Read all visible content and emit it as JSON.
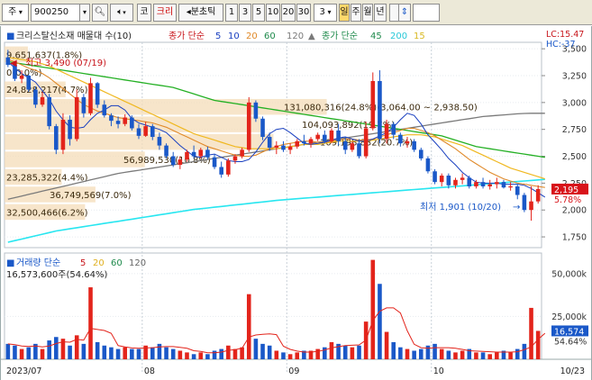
{
  "toolbar": {
    "market": "주",
    "code": "900250",
    "name_btn": "코",
    "name_text": "크리",
    "view_btn": "◂분초틱",
    "periods": [
      "1",
      "3",
      "5",
      "10",
      "20",
      "30"
    ],
    "period_count": "3",
    "units": [
      "일",
      "주",
      "월",
      "년"
    ],
    "selected_unit": "일"
  },
  "legend": {
    "title": "크리스탈신소재 매물대 수(10)",
    "ma_label": "종가 단순",
    "ma_periods": [
      "5",
      "10",
      "20",
      "60",
      "120"
    ],
    "ma_label2": "종가 단순",
    "ma_periods2": [
      "45",
      "200",
      "15"
    ],
    "lc": "LC:15.47",
    "hc": "HC:-37."
  },
  "price_annotations": {
    "high": "최고 3,490 (07/19)",
    "low": "최저 1,901 (10/20)",
    "current_price": "2,195",
    "current_pct": "5.78%"
  },
  "volume_profile": [
    {
      "label": "9,651,637(1.8%)",
      "pct": 1.8
    },
    {
      "label": "0(0.0%)",
      "pct": 0.0
    },
    {
      "label": "24,828,217(4.7%)",
      "pct": 4.7
    },
    {
      "label": "131,080,316(24.8%)(3,064.00 ~ 2,938.50)",
      "pct": 24.8
    },
    {
      "label": "104,093,892(19.7%)",
      "pct": 19.7
    },
    {
      "label": "109,198,832(20.7%)",
      "pct": 20.7
    },
    {
      "label": "56,989,530(10.8%)",
      "pct": 10.8
    },
    {
      "label": "23,285,322(4.4%)",
      "pct": 4.4
    },
    {
      "label": "36,749,569(7.0%)",
      "pct": 7.0
    },
    {
      "label": "32,500,466(6.2%)",
      "pct": 6.2
    }
  ],
  "price_axis": [
    "3,500",
    "3,250",
    "3,000",
    "2,750",
    "2,500",
    "2,250",
    "2,000",
    "1,750"
  ],
  "volume_legend": {
    "label": "거래량 단순",
    "periods": [
      "5",
      "20",
      "60",
      "120"
    ],
    "current": "16,573,600주(54.64%)"
  },
  "volume_axis": [
    "50,000k",
    "25,000k"
  ],
  "volume_current": "16,574",
  "volume_pct": "54.64%",
  "date_axis": [
    "2023/07",
    "08",
    "09",
    "10",
    "10/23"
  ],
  "colors": {
    "up": "#e3241b",
    "down": "#1a58c8",
    "ma5": "#1a40c0",
    "ma10": "#e08a2a",
    "ma20": "#f0b820",
    "ma60": "#24b024",
    "ma120": "#7a7a7a",
    "ma45": "#1f8a4c",
    "ma200": "#28e6f0",
    "ma15": "#e8cc30",
    "profile": "#f4dcb8"
  },
  "chart_data": {
    "type": "candlestick",
    "ylim": [
      1650,
      3560
    ],
    "volume_ylim": [
      0,
      62000
    ],
    "candles": [
      {
        "o": 3420,
        "h": 3490,
        "l": 3330,
        "c": 3350,
        "v": 9000
      },
      {
        "o": 3350,
        "h": 3380,
        "l": 3200,
        "c": 3220,
        "v": 8000
      },
      {
        "o": 3220,
        "h": 3300,
        "l": 3180,
        "c": 3250,
        "v": 6000
      },
      {
        "o": 3250,
        "h": 3260,
        "l": 3100,
        "c": 3120,
        "v": 7000
      },
      {
        "o": 3120,
        "h": 3150,
        "l": 2950,
        "c": 2980,
        "v": 9000
      },
      {
        "o": 2980,
        "h": 3100,
        "l": 2960,
        "c": 3050,
        "v": 6000
      },
      {
        "o": 3050,
        "h": 3080,
        "l": 2750,
        "c": 2780,
        "v": 11000
      },
      {
        "o": 2780,
        "h": 2800,
        "l": 2520,
        "c": 2560,
        "v": 13000
      },
      {
        "o": 2560,
        "h": 2900,
        "l": 2520,
        "c": 2840,
        "v": 12000
      },
      {
        "o": 2840,
        "h": 2880,
        "l": 2600,
        "c": 2660,
        "v": 8000
      },
      {
        "o": 2660,
        "h": 3120,
        "l": 2640,
        "c": 3050,
        "v": 14000
      },
      {
        "o": 3050,
        "h": 3080,
        "l": 2860,
        "c": 2900,
        "v": 9000
      },
      {
        "o": 2900,
        "h": 3230,
        "l": 2880,
        "c": 3180,
        "v": 42000
      },
      {
        "o": 3180,
        "h": 3190,
        "l": 2950,
        "c": 2980,
        "v": 10000
      },
      {
        "o": 2980,
        "h": 3020,
        "l": 2860,
        "c": 2880,
        "v": 8000
      },
      {
        "o": 2880,
        "h": 2900,
        "l": 2780,
        "c": 2830,
        "v": 7000
      },
      {
        "o": 2830,
        "h": 2870,
        "l": 2760,
        "c": 2800,
        "v": 6000
      },
      {
        "o": 2800,
        "h": 2890,
        "l": 2780,
        "c": 2860,
        "v": 7000
      },
      {
        "o": 2860,
        "h": 2880,
        "l": 2740,
        "c": 2760,
        "v": 6000
      },
      {
        "o": 2760,
        "h": 2800,
        "l": 2660,
        "c": 2690,
        "v": 6000
      },
      {
        "o": 2690,
        "h": 2820,
        "l": 2680,
        "c": 2780,
        "v": 8000
      },
      {
        "o": 2780,
        "h": 2800,
        "l": 2650,
        "c": 2680,
        "v": 7000
      },
      {
        "o": 2680,
        "h": 2720,
        "l": 2560,
        "c": 2600,
        "v": 9000
      },
      {
        "o": 2600,
        "h": 2620,
        "l": 2480,
        "c": 2500,
        "v": 7000
      },
      {
        "o": 2500,
        "h": 2540,
        "l": 2400,
        "c": 2420,
        "v": 6000
      },
      {
        "o": 2420,
        "h": 2500,
        "l": 2380,
        "c": 2470,
        "v": 5000
      },
      {
        "o": 2470,
        "h": 2560,
        "l": 2450,
        "c": 2540,
        "v": 4000
      },
      {
        "o": 2540,
        "h": 2600,
        "l": 2480,
        "c": 2500,
        "v": 3000
      },
      {
        "o": 2500,
        "h": 2580,
        "l": 2480,
        "c": 2560,
        "v": 4000
      },
      {
        "o": 2560,
        "h": 2590,
        "l": 2470,
        "c": 2490,
        "v": 3000
      },
      {
        "o": 2490,
        "h": 2520,
        "l": 2380,
        "c": 2400,
        "v": 5000
      },
      {
        "o": 2400,
        "h": 2450,
        "l": 2300,
        "c": 2330,
        "v": 6000
      },
      {
        "o": 2330,
        "h": 2480,
        "l": 2310,
        "c": 2460,
        "v": 8000
      },
      {
        "o": 2460,
        "h": 2520,
        "l": 2430,
        "c": 2500,
        "v": 6000
      },
      {
        "o": 2500,
        "h": 2580,
        "l": 2480,
        "c": 2560,
        "v": 7000
      },
      {
        "o": 2560,
        "h": 3050,
        "l": 2540,
        "c": 3000,
        "v": 38000
      },
      {
        "o": 3000,
        "h": 3020,
        "l": 2820,
        "c": 2850,
        "v": 12000
      },
      {
        "o": 2850,
        "h": 2870,
        "l": 2650,
        "c": 2680,
        "v": 9000
      },
      {
        "o": 2680,
        "h": 2720,
        "l": 2550,
        "c": 2580,
        "v": 8000
      },
      {
        "o": 2580,
        "h": 2640,
        "l": 2520,
        "c": 2600,
        "v": 5000
      },
      {
        "o": 2600,
        "h": 2640,
        "l": 2540,
        "c": 2560,
        "v": 4000
      },
      {
        "o": 2560,
        "h": 2620,
        "l": 2520,
        "c": 2590,
        "v": 3000
      },
      {
        "o": 2590,
        "h": 2660,
        "l": 2570,
        "c": 2640,
        "v": 4000
      },
      {
        "o": 2640,
        "h": 2700,
        "l": 2600,
        "c": 2620,
        "v": 5000
      },
      {
        "o": 2620,
        "h": 2680,
        "l": 2580,
        "c": 2660,
        "v": 5000
      },
      {
        "o": 2660,
        "h": 2720,
        "l": 2640,
        "c": 2700,
        "v": 6000
      },
      {
        "o": 2700,
        "h": 2740,
        "l": 2620,
        "c": 2640,
        "v": 7000
      },
      {
        "o": 2640,
        "h": 2760,
        "l": 2620,
        "c": 2740,
        "v": 10000
      },
      {
        "o": 2740,
        "h": 2800,
        "l": 2600,
        "c": 2640,
        "v": 9000
      },
      {
        "o": 2640,
        "h": 2680,
        "l": 2520,
        "c": 2560,
        "v": 8000
      },
      {
        "o": 2560,
        "h": 2640,
        "l": 2540,
        "c": 2620,
        "v": 7000
      },
      {
        "o": 2620,
        "h": 2660,
        "l": 2480,
        "c": 2500,
        "v": 8000
      },
      {
        "o": 2500,
        "h": 2820,
        "l": 2480,
        "c": 2760,
        "v": 22000
      },
      {
        "o": 2760,
        "h": 3280,
        "l": 2740,
        "c": 3200,
        "v": 58000
      },
      {
        "o": 3200,
        "h": 3300,
        "l": 2620,
        "c": 2660,
        "v": 44000
      },
      {
        "o": 2660,
        "h": 2840,
        "l": 2620,
        "c": 2800,
        "v": 16000
      },
      {
        "o": 2800,
        "h": 2820,
        "l": 2660,
        "c": 2700,
        "v": 10000
      },
      {
        "o": 2700,
        "h": 2720,
        "l": 2590,
        "c": 2620,
        "v": 7000
      },
      {
        "o": 2620,
        "h": 2680,
        "l": 2580,
        "c": 2640,
        "v": 6000
      },
      {
        "o": 2640,
        "h": 2660,
        "l": 2540,
        "c": 2560,
        "v": 5000
      },
      {
        "o": 2560,
        "h": 2580,
        "l": 2460,
        "c": 2480,
        "v": 6000
      },
      {
        "o": 2480,
        "h": 2500,
        "l": 2340,
        "c": 2360,
        "v": 8000
      },
      {
        "o": 2360,
        "h": 2380,
        "l": 2240,
        "c": 2260,
        "v": 9000
      },
      {
        "o": 2260,
        "h": 2340,
        "l": 2220,
        "c": 2320,
        "v": 6000
      },
      {
        "o": 2320,
        "h": 2340,
        "l": 2200,
        "c": 2230,
        "v": 5000
      },
      {
        "o": 2230,
        "h": 2300,
        "l": 2200,
        "c": 2280,
        "v": 4000
      },
      {
        "o": 2280,
        "h": 2340,
        "l": 2240,
        "c": 2300,
        "v": 5000
      },
      {
        "o": 2300,
        "h": 2320,
        "l": 2200,
        "c": 2220,
        "v": 6000
      },
      {
        "o": 2220,
        "h": 2280,
        "l": 2200,
        "c": 2260,
        "v": 4000
      },
      {
        "o": 2260,
        "h": 2300,
        "l": 2200,
        "c": 2220,
        "v": 4000
      },
      {
        "o": 2220,
        "h": 2280,
        "l": 2190,
        "c": 2240,
        "v": 3000
      },
      {
        "o": 2240,
        "h": 2300,
        "l": 2200,
        "c": 2260,
        "v": 4000
      },
      {
        "o": 2260,
        "h": 2280,
        "l": 2200,
        "c": 2210,
        "v": 5000
      },
      {
        "o": 2210,
        "h": 2260,
        "l": 2180,
        "c": 2220,
        "v": 4000
      },
      {
        "o": 2220,
        "h": 2240,
        "l": 2100,
        "c": 2140,
        "v": 6000
      },
      {
        "o": 2140,
        "h": 2160,
        "l": 1980,
        "c": 2000,
        "v": 9000
      },
      {
        "o": 2000,
        "h": 2220,
        "l": 1901,
        "c": 2080,
        "v": 30000
      },
      {
        "o": 2080,
        "h": 2230,
        "l": 2060,
        "c": 2195,
        "v": 16574
      }
    ],
    "ma5": [
      3380,
      3320,
      3270,
      3230,
      3190,
      3110,
      3030,
      2920,
      2840,
      2770,
      2760,
      2770,
      2840,
      2900,
      2930,
      2970,
      2970,
      2930,
      2850,
      2810,
      2790,
      2770,
      2750,
      2720,
      2660,
      2600,
      2550,
      2500,
      2490,
      2510,
      2520,
      2490,
      2460,
      2450,
      2450,
      2470,
      2540,
      2630,
      2710,
      2750,
      2760,
      2720,
      2670,
      2620,
      2610,
      2620,
      2630,
      2650,
      2670,
      2680,
      2660,
      2640,
      2640,
      2660,
      2690,
      2720,
      2770,
      2840,
      2900,
      2880,
      2800,
      2700,
      2630,
      2560,
      2480,
      2420,
      2350,
      2300,
      2260,
      2250,
      2250,
      2250,
      2240,
      2240,
      2240,
      2230,
      2200,
      2160,
      2120
    ],
    "ma10": [
      3400,
      3380,
      3350,
      3320,
      3300,
      3270,
      3230,
      3180,
      3130,
      3080,
      3030,
      2980,
      2950,
      2920,
      2900,
      2880,
      2860,
      2850,
      2840,
      2830,
      2820,
      2810,
      2790,
      2770,
      2740,
      2710,
      2680,
      2650,
      2620,
      2590,
      2570,
      2550,
      2530,
      2510,
      2500,
      2500,
      2510,
      2540,
      2570,
      2590,
      2610,
      2620,
      2630,
      2640,
      2640,
      2630,
      2630,
      2640,
      2650,
      2660,
      2660,
      2650,
      2650,
      2660,
      2680,
      2700,
      2720,
      2740,
      2760,
      2760,
      2740,
      2720,
      2690,
      2650,
      2610,
      2570,
      2520,
      2470,
      2430,
      2390,
      2350,
      2320,
      2290,
      2270,
      2250,
      2240,
      2230,
      2220,
      2210
    ],
    "ma20": [
      3420,
      3410,
      3400,
      3390,
      3380,
      3360,
      3340,
      3310,
      3280,
      3250,
      3220,
      3190,
      3160,
      3130,
      3100,
      3070,
      3040,
      3010,
      2980,
      2950,
      2920,
      2890,
      2860,
      2830,
      2800,
      2770,
      2740,
      2710,
      2690,
      2670,
      2650,
      2630,
      2610,
      2590,
      2580,
      2570,
      2570,
      2570,
      2570,
      2570,
      2580,
      2590,
      2600,
      2610,
      2610,
      2610,
      2620,
      2630,
      2640,
      2640,
      2640,
      2640,
      2640,
      2650,
      2660,
      2670,
      2680,
      2690,
      2700,
      2700,
      2700,
      2690,
      2680,
      2660,
      2640,
      2620,
      2600,
      2570,
      2540,
      2510,
      2480,
      2450,
      2420,
      2390,
      2370,
      2350,
      2330,
      2310,
      2290
    ],
    "ma60": [
      3380,
      3370,
      3360,
      3350,
      3340,
      3330,
      3320,
      3310,
      3300,
      3290,
      3280,
      3270,
      3260,
      3250,
      3240,
      3230,
      3220,
      3210,
      3200,
      3190,
      3180,
      3170,
      3160,
      3150,
      3140,
      3120,
      3100,
      3080,
      3060,
      3040,
      3020,
      3010,
      3000,
      2990,
      2980,
      2970,
      2960,
      2950,
      2940,
      2930,
      2920,
      2910,
      2900,
      2890,
      2880,
      2870,
      2860,
      2850,
      2840,
      2830,
      2820,
      2810,
      2800,
      2790,
      2780,
      2770,
      2760,
      2750,
      2740,
      2730,
      2720,
      2710,
      2700,
      2690,
      2670,
      2650,
      2630,
      2610,
      2590,
      2580,
      2570,
      2560,
      2550,
      2540,
      2530,
      2520,
      2510,
      2500,
      2490
    ],
    "ma120": [
      2100,
      2115,
      2130,
      2145,
      2160,
      2175,
      2190,
      2205,
      2220,
      2235,
      2250,
      2265,
      2280,
      2295,
      2310,
      2325,
      2340,
      2350,
      2360,
      2370,
      2380,
      2390,
      2400,
      2410,
      2420,
      2430,
      2440,
      2450,
      2460,
      2470,
      2480,
      2490,
      2500,
      2510,
      2520,
      2530,
      2540,
      2550,
      2560,
      2570,
      2580,
      2590,
      2600,
      2610,
      2620,
      2630,
      2640,
      2650,
      2660,
      2670,
      2680,
      2690,
      2700,
      2710,
      2720,
      2730,
      2740,
      2750,
      2760,
      2770,
      2780,
      2790,
      2800,
      2810,
      2820,
      2830,
      2840,
      2850,
      2860,
      2870,
      2875,
      2880,
      2885,
      2890,
      2895,
      2898,
      2900,
      2900,
      2900
    ],
    "ma200": [
      1700,
      1715,
      1730,
      1745,
      1760,
      1775,
      1790,
      1805,
      1815,
      1825,
      1835,
      1845,
      1855,
      1865,
      1875,
      1885,
      1895,
      1905,
      1915,
      1925,
      1935,
      1945,
      1955,
      1965,
      1975,
      1985,
      1995,
      2005,
      2012,
      2019,
      2026,
      2033,
      2040,
      2047,
      2054,
      2061,
      2068,
      2075,
      2082,
      2089,
      2095,
      2100,
      2105,
      2110,
      2115,
      2120,
      2125,
      2130,
      2135,
      2140,
      2145,
      2150,
      2155,
      2160,
      2165,
      2170,
      2175,
      2180,
      2185,
      2190,
      2195,
      2200,
      2205,
      2210,
      2215,
      2220,
      2225,
      2230,
      2235,
      2240,
      2245,
      2250,
      2255,
      2260,
      2265,
      2270,
      2275,
      2280,
      2285
    ],
    "vol_ma5": [
      9000,
      8500,
      7700,
      7500,
      7800,
      7200,
      7800,
      9200,
      10200,
      10000,
      11600,
      11200,
      18000,
      17400,
      16800,
      15200,
      8000,
      7200,
      6600,
      6400,
      6600,
      6800,
      7200,
      7400,
      7400,
      7000,
      6400,
      5000,
      4600,
      3800,
      3800,
      4200,
      5200,
      5600,
      6400,
      13000,
      14200,
      14600,
      14800,
      14400,
      7600,
      5800,
      4800,
      4200,
      4200,
      4600,
      5400,
      6600,
      7400,
      8000,
      8200,
      8400,
      11200,
      22600,
      28000,
      30000,
      30000,
      27000,
      16600,
      8800,
      6800,
      6400,
      6800,
      6800,
      6800,
      6400,
      5800,
      5000,
      4800,
      4600,
      4400,
      4200,
      4200,
      4200,
      4400,
      5600,
      7200,
      11600,
      15200
    ]
  }
}
